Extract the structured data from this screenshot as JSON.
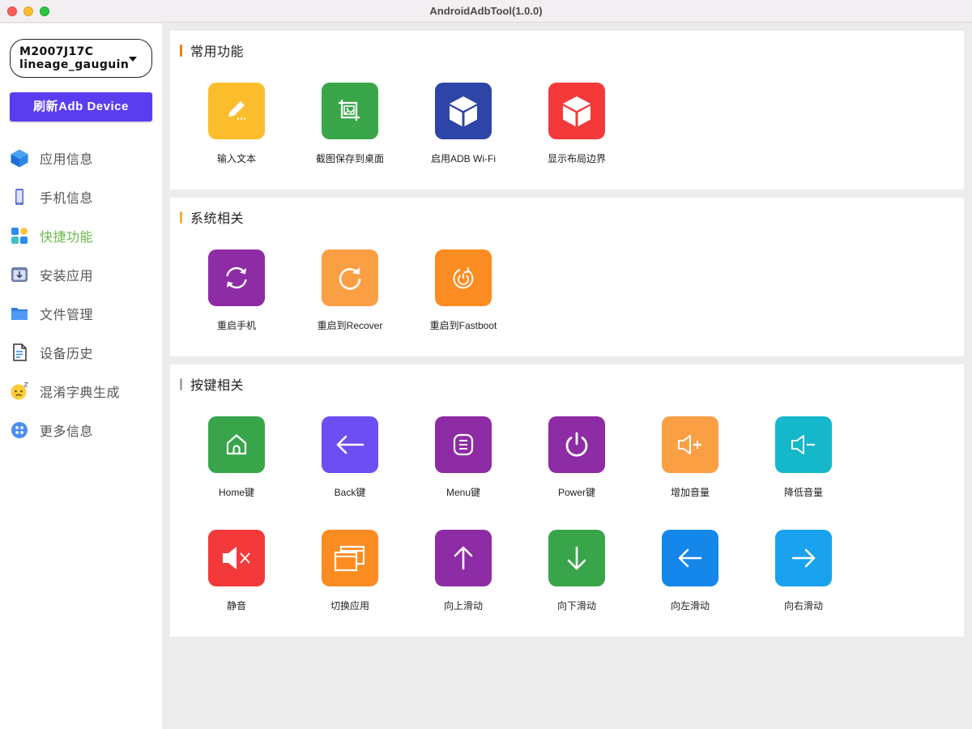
{
  "window": {
    "title": "AndroidAdbTool(1.0.0)"
  },
  "sidebar": {
    "device": {
      "line1": "M2007J17C",
      "line2": "lineage_gauguin"
    },
    "refresh_button": "刷新Adb Device",
    "items": [
      {
        "label": "应用信息",
        "icon": "cube-icon",
        "active": false
      },
      {
        "label": "手机信息",
        "icon": "phone-icon",
        "active": false
      },
      {
        "label": "快捷功能",
        "icon": "grid-icon",
        "active": true
      },
      {
        "label": "安装应用",
        "icon": "install-icon",
        "active": false
      },
      {
        "label": "文件管理",
        "icon": "folder-icon",
        "active": false
      },
      {
        "label": "设备历史",
        "icon": "document-icon",
        "active": false
      },
      {
        "label": "混淆字典生成",
        "icon": "emoji-icon",
        "active": false
      },
      {
        "label": "更多信息",
        "icon": "more-icon",
        "active": false
      }
    ],
    "active_color": "#6ab94c"
  },
  "sections": [
    {
      "title": "常用功能",
      "bar_color": "#f57c00",
      "tiles": [
        {
          "label": "输入文本",
          "icon": "pencil-icon",
          "color": "#fbbd2b"
        },
        {
          "label": "截图保存到桌面",
          "icon": "screenshot-icon",
          "color": "#3aa64a"
        },
        {
          "label": "启用ADB Wi-Fi",
          "icon": "cube-icon",
          "color": "#2e45a8"
        },
        {
          "label": "显示布局边界",
          "icon": "cube-icon",
          "color": "#f4393a"
        }
      ]
    },
    {
      "title": "系统相关",
      "bar_color": "#f9b233",
      "tiles": [
        {
          "label": "重启手机",
          "icon": "sync-icon",
          "color": "#8e2ca5"
        },
        {
          "label": "重启到Recover",
          "icon": "refresh-icon",
          "color": "#fb9f45"
        },
        {
          "label": "重启到Fastboot",
          "icon": "power-circle-icon",
          "color": "#fb8c22"
        }
      ]
    },
    {
      "title": "按键相关",
      "bar_color": "#a3acb8",
      "tiles": [
        {
          "label": "Home键",
          "icon": "home-icon",
          "color": "#39a54b"
        },
        {
          "label": "Back键",
          "icon": "arrow-back-icon",
          "color": "#6c4ef3"
        },
        {
          "label": "Menu键",
          "icon": "menu-icon",
          "color": "#8e2ca5"
        },
        {
          "label": "Power键",
          "icon": "power-icon",
          "color": "#8e2ca5"
        },
        {
          "label": "增加音量",
          "icon": "volume-up-icon",
          "color": "#fb9f45"
        },
        {
          "label": "降低音量",
          "icon": "volume-down-icon",
          "color": "#15b8ca"
        },
        {
          "label": "静音",
          "icon": "mute-icon",
          "color": "#f4393a"
        },
        {
          "label": "切换应用",
          "icon": "switch-app-icon",
          "color": "#fb8c22"
        },
        {
          "label": "向上滑动",
          "icon": "arrow-up-icon",
          "color": "#8e2ca5"
        },
        {
          "label": "向下滑动",
          "icon": "arrow-down-icon",
          "color": "#39a54b"
        },
        {
          "label": "向左滑动",
          "icon": "arrow-left-icon",
          "color": "#1587ea"
        },
        {
          "label": "向右滑动",
          "icon": "arrow-right-icon",
          "color": "#1aa2ef"
        }
      ]
    }
  ]
}
